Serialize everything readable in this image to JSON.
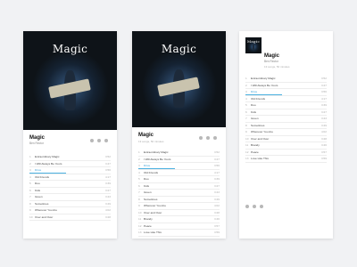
{
  "album": {
    "cover_title": "Magic",
    "title": "Magic",
    "artist": "Ben Rector",
    "meta": "13 songs, 50 minutes",
    "accent": "#3aa0d8"
  },
  "controls": [
    {
      "icon": "shuffle-icon"
    },
    {
      "icon": "download-icon"
    },
    {
      "icon": "more-icon"
    }
  ],
  "player": {
    "active_track": 3,
    "progress": 0.45
  },
  "tracks": [
    {
      "num": "1",
      "name": "Extraordinary Magic",
      "dur": "3:52"
    },
    {
      "num": "2",
      "name": "I Will Always Be Yours",
      "dur": "3:47"
    },
    {
      "num": "3",
      "name": "Drive",
      "dur": "3:56"
    },
    {
      "num": "4",
      "name": "Old Friends",
      "dur": "4:17"
    },
    {
      "num": "5",
      "name": "Duo",
      "dur": "3:39"
    },
    {
      "num": "6",
      "name": "Kids",
      "dur": "3:27"
    },
    {
      "num": "7",
      "name": "Green",
      "dur": "3:43"
    },
    {
      "num": "8",
      "name": "Sometimes",
      "dur": "3:49"
    },
    {
      "num": "9",
      "name": "Wherever You Are",
      "dur": "4:02"
    },
    {
      "num": "10",
      "name": "Over and Over",
      "dur": "3:28"
    },
    {
      "num": "11",
      "name": "Brandy",
      "dur": "3:46"
    },
    {
      "num": "12",
      "name": "Peace",
      "dur": "3:57"
    },
    {
      "num": "13",
      "name": "Love Like This",
      "dur": "3:59"
    }
  ]
}
